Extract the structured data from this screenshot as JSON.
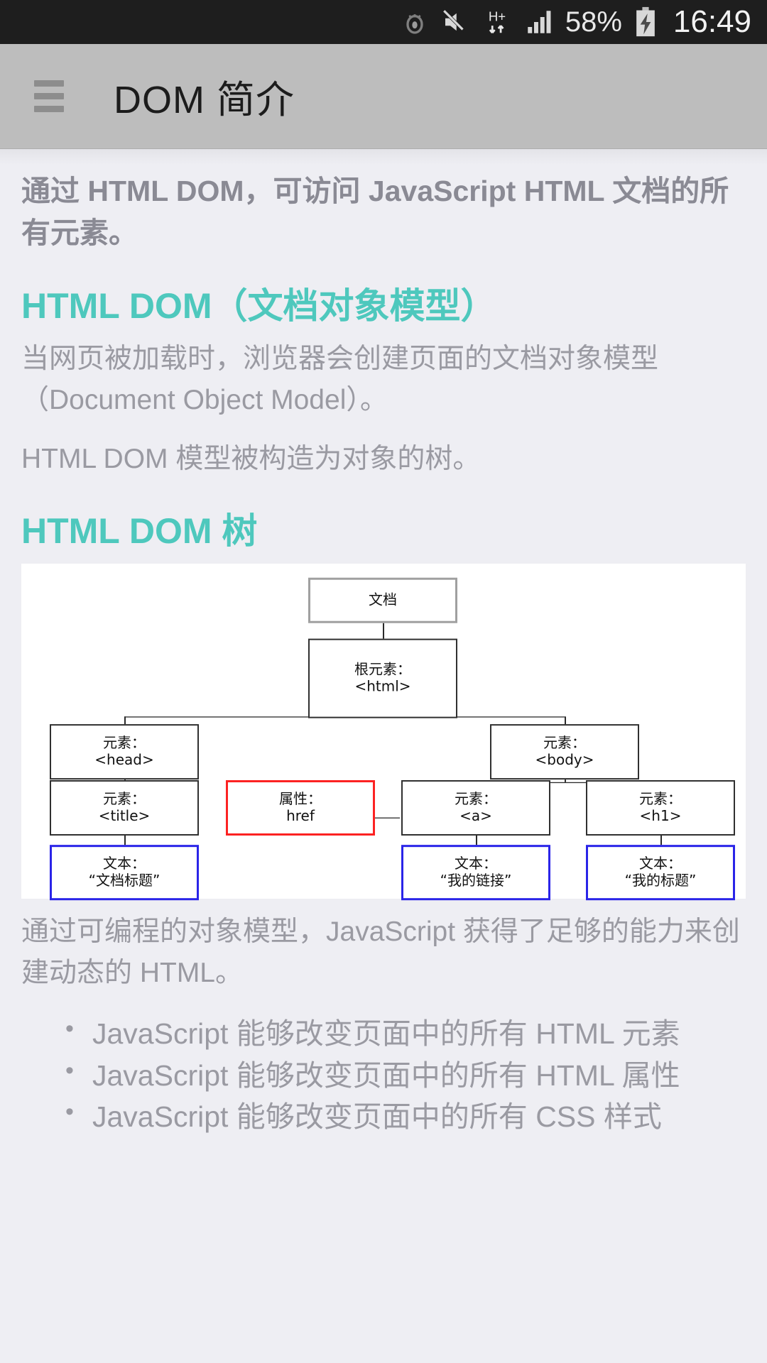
{
  "statusbar": {
    "icons": [
      "eye-icon",
      "mute-icon",
      "hsdpa-icon",
      "signal-icon"
    ],
    "network_label": "H+",
    "battery_percent": "58%",
    "time": "16:49"
  },
  "appbar": {
    "menu_icon": "hamburger-icon",
    "title": "DOM 简介",
    "background": "#bdbdbd"
  },
  "theme": {
    "accent": "#4ec8bd",
    "page_bg": "#eeeef3",
    "body_text": "#9a9aa2"
  },
  "article": {
    "lead": "通过 HTML DOM，可访问 JavaScript HTML 文档的所有元素。",
    "section1_heading": "HTML DOM（文档对象模型）",
    "p1": "当网页被加载时，浏览器会创建页面的文档对象模型（Document Object Model）。",
    "p2": "HTML DOM 模型被构造为对象的树。",
    "section2_heading": "HTML DOM 树",
    "p3": "通过可编程的对象模型，JavaScript 获得了足够的能力来创建动态的 HTML。",
    "bullets": [
      "JavaScript 能够改变页面中的所有 HTML 元素",
      "JavaScript 能够改变页面中的所有 HTML 属性",
      "JavaScript 能够改变页面中的所有 CSS 样式"
    ]
  },
  "diagram": {
    "name": "html-dom-tree",
    "nodes": {
      "document": {
        "line1": "文档",
        "line2": "",
        "border": "#a0a0a0"
      },
      "root": {
        "line1": "根元素：",
        "line2": "<html>",
        "border": "#303030"
      },
      "head": {
        "line1": "元素：",
        "line2": "<head>",
        "border": "#303030"
      },
      "body": {
        "line1": "元素：",
        "line2": "<body>",
        "border": "#303030"
      },
      "title": {
        "line1": "元素：",
        "line2": "<title>",
        "border": "#303030"
      },
      "attr_href": {
        "line1": "属性：",
        "line2": "href",
        "border": "#fc2222"
      },
      "anchor": {
        "line1": "元素：",
        "line2": "<a>",
        "border": "#303030"
      },
      "h1": {
        "line1": "元素：",
        "line2": "<h1>",
        "border": "#303030"
      },
      "text_title": {
        "line1": "文本：",
        "line2": "“文档标题”",
        "border": "#2a24e8"
      },
      "text_link": {
        "line1": "文本：",
        "line2": "“我的链接”",
        "border": "#2a24e8"
      },
      "text_head": {
        "line1": "文本：",
        "line2": "“我的标题”",
        "border": "#2a24e8"
      }
    }
  }
}
